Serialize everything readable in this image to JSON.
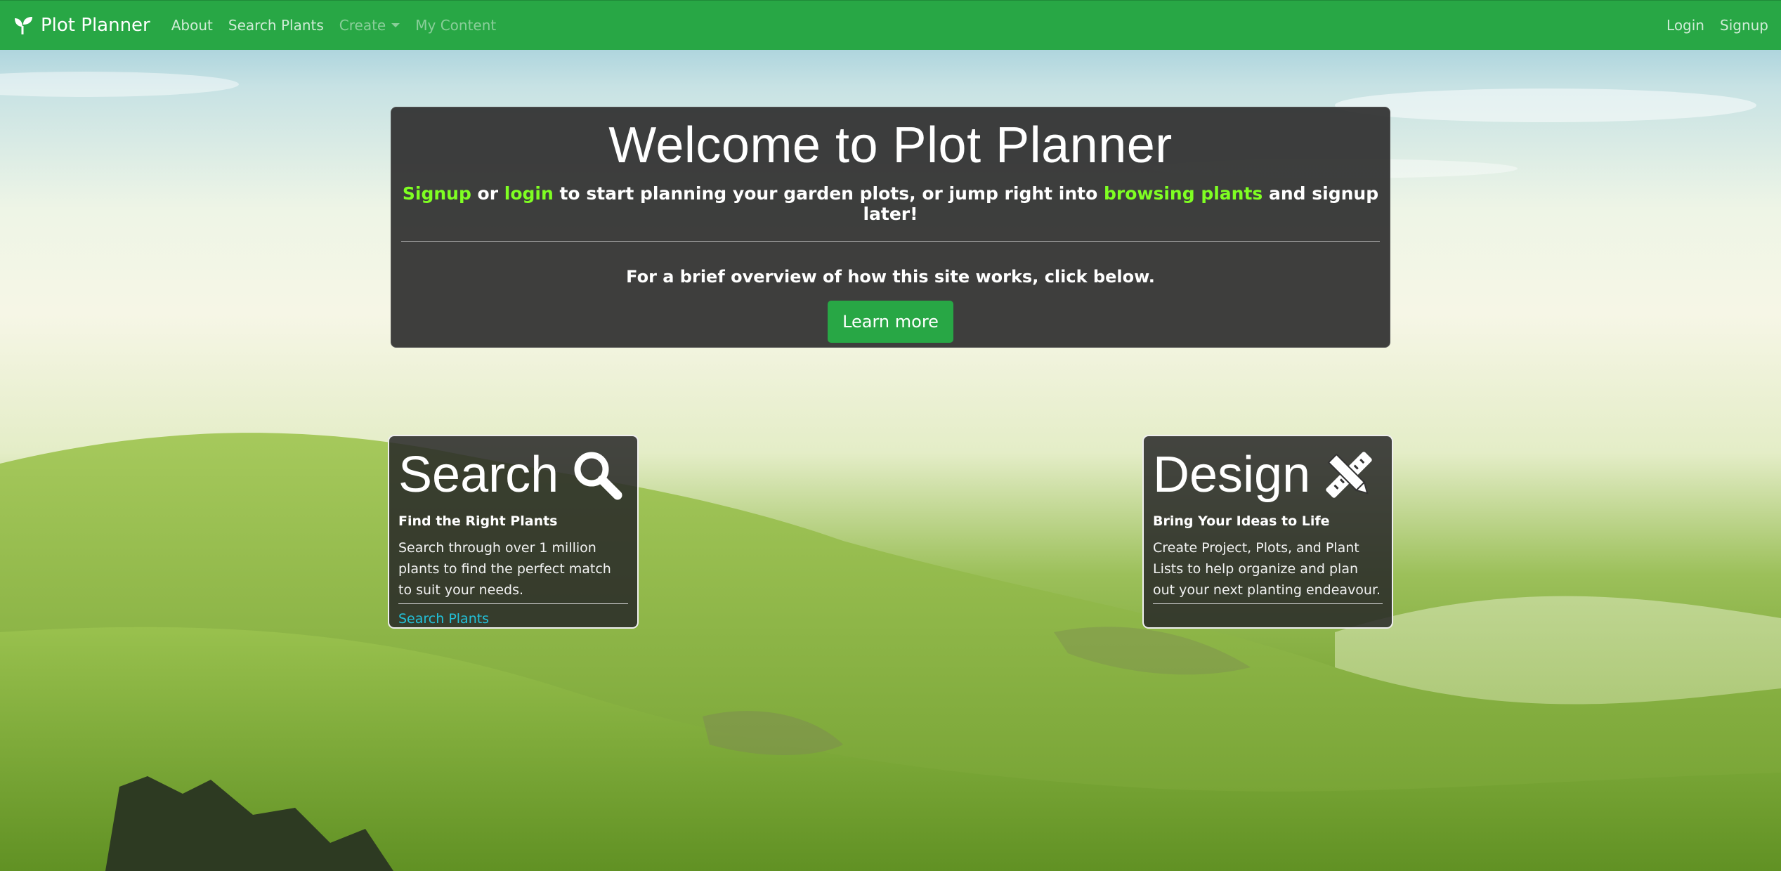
{
  "navbar": {
    "brand": "Plot Planner",
    "links": [
      "About",
      "Search Plants"
    ],
    "create_label": "Create",
    "my_content_label": "My Content",
    "login_label": "Login",
    "signup_label": "Signup",
    "color": "#28a745"
  },
  "jumbotron": {
    "title": "Welcome to Plot Planner",
    "lead": {
      "signup": "Signup",
      "or": " or ",
      "login": "login",
      "middle": " to start planning your garden plots, or jump right into ",
      "browse": "browsing plants",
      "end": " and signup later!"
    },
    "subtext": "For a brief overview of how this site works, click below.",
    "button_label": "Learn more"
  },
  "cards": {
    "search": {
      "title": "Search",
      "icon": "magnifier-icon",
      "subtitle": "Find the Right Plants",
      "text": "Search through over 1 million plants to find the perfect match to suit your needs.",
      "link": "Search Plants"
    },
    "design": {
      "title": "Design",
      "icon": "pencil-ruler-icon",
      "subtitle": "Bring Your Ideas to Life",
      "text": "Create Project, Plots, and Plant Lists to help organize and plan out your next planting endeavour."
    }
  },
  "colors": {
    "accent_green": "#28a745",
    "link_lime": "#7fff22",
    "link_cyan": "#22c0d8"
  }
}
